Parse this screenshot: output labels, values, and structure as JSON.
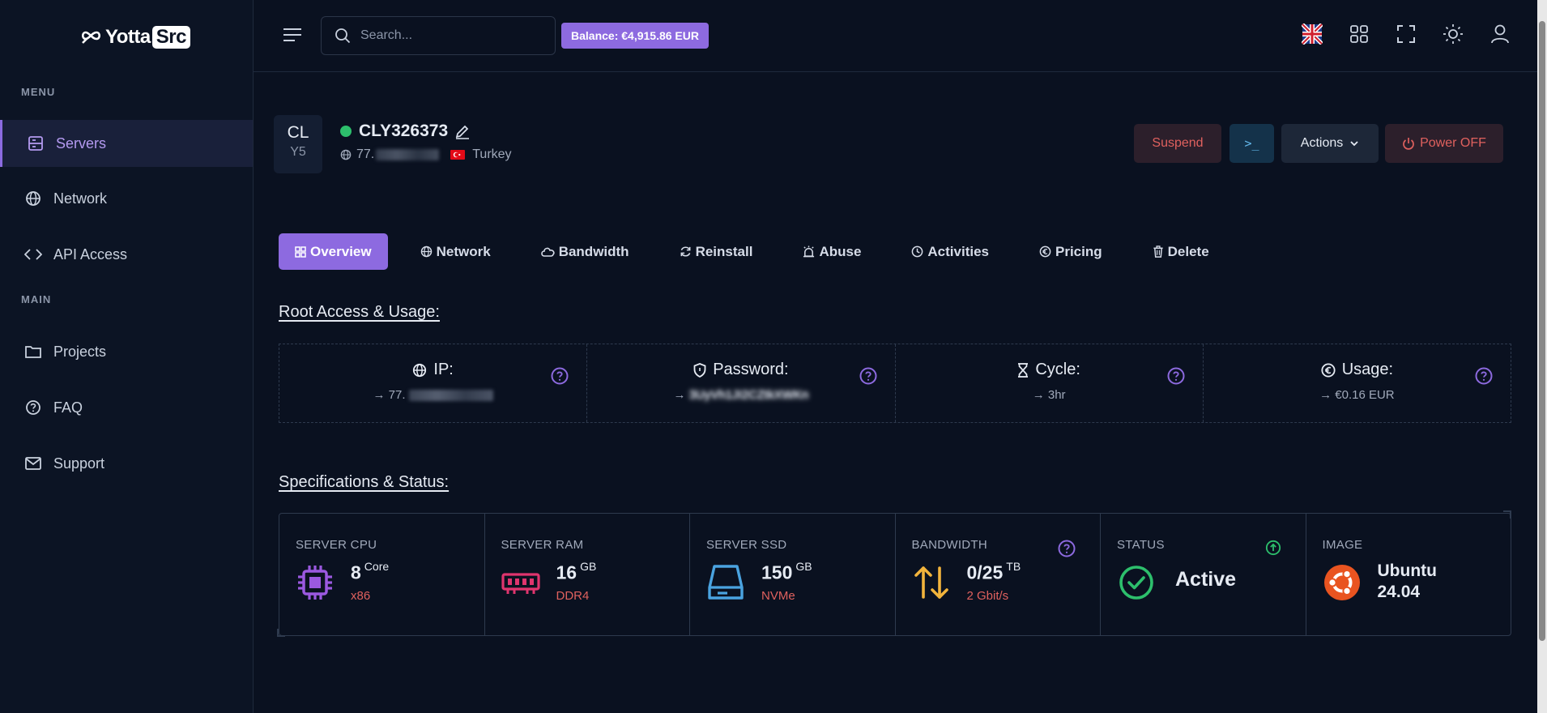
{
  "brand": {
    "logo_text_a": "Yotta",
    "logo_text_b": "Src"
  },
  "sidebar": {
    "menu_label": "MENU",
    "main_label": "MAIN",
    "menu_items": [
      {
        "label": "Servers",
        "icon": "server-icon"
      },
      {
        "label": "Network",
        "icon": "globe-icon"
      },
      {
        "label": "API Access",
        "icon": "code-icon"
      }
    ],
    "main_items": [
      {
        "label": "Projects",
        "icon": "folder-icon"
      },
      {
        "label": "FAQ",
        "icon": "question-icon"
      },
      {
        "label": "Support",
        "icon": "mail-icon"
      }
    ]
  },
  "topbar": {
    "search_placeholder": "Search...",
    "balance": "Balance: €4,915.86 EUR"
  },
  "server": {
    "badge_top": "CL",
    "badge_bottom": "Y5",
    "name": "CLY326373",
    "ip_prefix": "77.",
    "country": "Turkey",
    "status_color": "#2dbf6c"
  },
  "actions": {
    "suspend": "Suspend",
    "console": ">_",
    "actions": "Actions",
    "power_off": "Power OFF"
  },
  "tabs": [
    {
      "label": "Overview",
      "icon": "grid-icon"
    },
    {
      "label": "Network",
      "icon": "globe-icon"
    },
    {
      "label": "Bandwidth",
      "icon": "cloud-icon"
    },
    {
      "label": "Reinstall",
      "icon": "refresh-icon"
    },
    {
      "label": "Abuse",
      "icon": "alarm-icon"
    },
    {
      "label": "Activities",
      "icon": "clock-icon"
    },
    {
      "label": "Pricing",
      "icon": "euro-icon"
    },
    {
      "label": "Delete",
      "icon": "trash-icon"
    }
  ],
  "root_access": {
    "title": "Root Access & Usage:",
    "ip_label": "IP:",
    "ip_value_prefix": "→ 77.",
    "password_label": "Password:",
    "password_value": "3UyVh1JI2CZtkXWKn",
    "cycle_label": "Cycle:",
    "cycle_value": "→ 3hr",
    "usage_label": "Usage:",
    "usage_value": "→ €0.16 EUR"
  },
  "specs": {
    "title": "Specifications & Status:",
    "cpu": {
      "caption": "SERVER CPU",
      "value": "8",
      "unit": "Core",
      "sub": "x86"
    },
    "ram": {
      "caption": "SERVER RAM",
      "value": "16",
      "unit": "GB",
      "sub": "DDR4"
    },
    "ssd": {
      "caption": "SERVER SSD",
      "value": "150",
      "unit": "GB",
      "sub": "NVMe"
    },
    "bandwidth": {
      "caption": "BANDWIDTH",
      "value": "0/25",
      "unit": "TB",
      "sub": "2 Gbit/s"
    },
    "status": {
      "caption": "STATUS",
      "value": "Active"
    },
    "image": {
      "caption": "IMAGE",
      "line1": "Ubuntu",
      "line2": "24.04"
    }
  },
  "colors": {
    "accent": "#8d6ae0",
    "danger": "#e0615e",
    "success": "#2dbf6c",
    "cpu": "#9b59e0",
    "ram": "#e0356e",
    "ssd": "#4aa3e0",
    "bandwidth": "#f2b43c",
    "ubuntu": "#e95420"
  }
}
